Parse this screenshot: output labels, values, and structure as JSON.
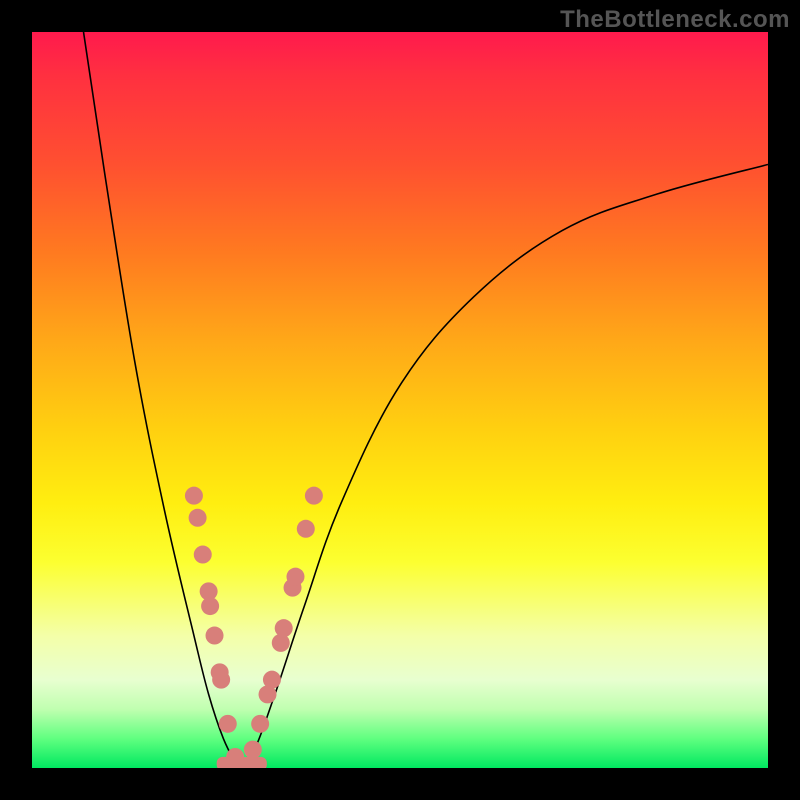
{
  "watermark": "TheBottleneck.com",
  "chart_data": {
    "type": "line",
    "title": "",
    "xlabel": "",
    "ylabel": "",
    "xlim": [
      0,
      100
    ],
    "ylim": [
      0,
      100
    ],
    "series": [
      {
        "name": "bottleneck-curve-left",
        "x": [
          7,
          10,
          14,
          18,
          22,
          24,
          26,
          28
        ],
        "y": [
          100,
          80,
          55,
          35,
          18,
          10,
          4,
          0
        ]
      },
      {
        "name": "bottleneck-curve-right",
        "x": [
          28,
          30,
          33,
          37,
          42,
          50,
          60,
          72,
          85,
          100
        ],
        "y": [
          0,
          2,
          10,
          22,
          36,
          52,
          64,
          73,
          78,
          82
        ]
      }
    ],
    "markers_left": {
      "x": [
        22.0,
        22.5,
        23.2,
        24.0,
        24.2,
        24.8,
        25.5,
        25.7,
        26.6,
        27.6
      ],
      "y": [
        37.0,
        34.0,
        29.0,
        24.0,
        22.0,
        18.0,
        13.0,
        12.0,
        6.0,
        1.5
      ]
    },
    "markers_right": {
      "x": [
        30.0,
        31.0,
        32.0,
        32.6,
        33.8,
        34.2,
        35.4,
        35.8,
        37.2,
        38.3
      ],
      "y": [
        2.5,
        6.0,
        10.0,
        12.0,
        17.0,
        19.0,
        24.5,
        26.0,
        32.5,
        37.0
      ]
    },
    "bottom_bar": {
      "x_start": 25.5,
      "x_end": 31.5,
      "y": 0.7
    },
    "marker_color": "#d87f7a",
    "marker_radius_px": 9
  }
}
